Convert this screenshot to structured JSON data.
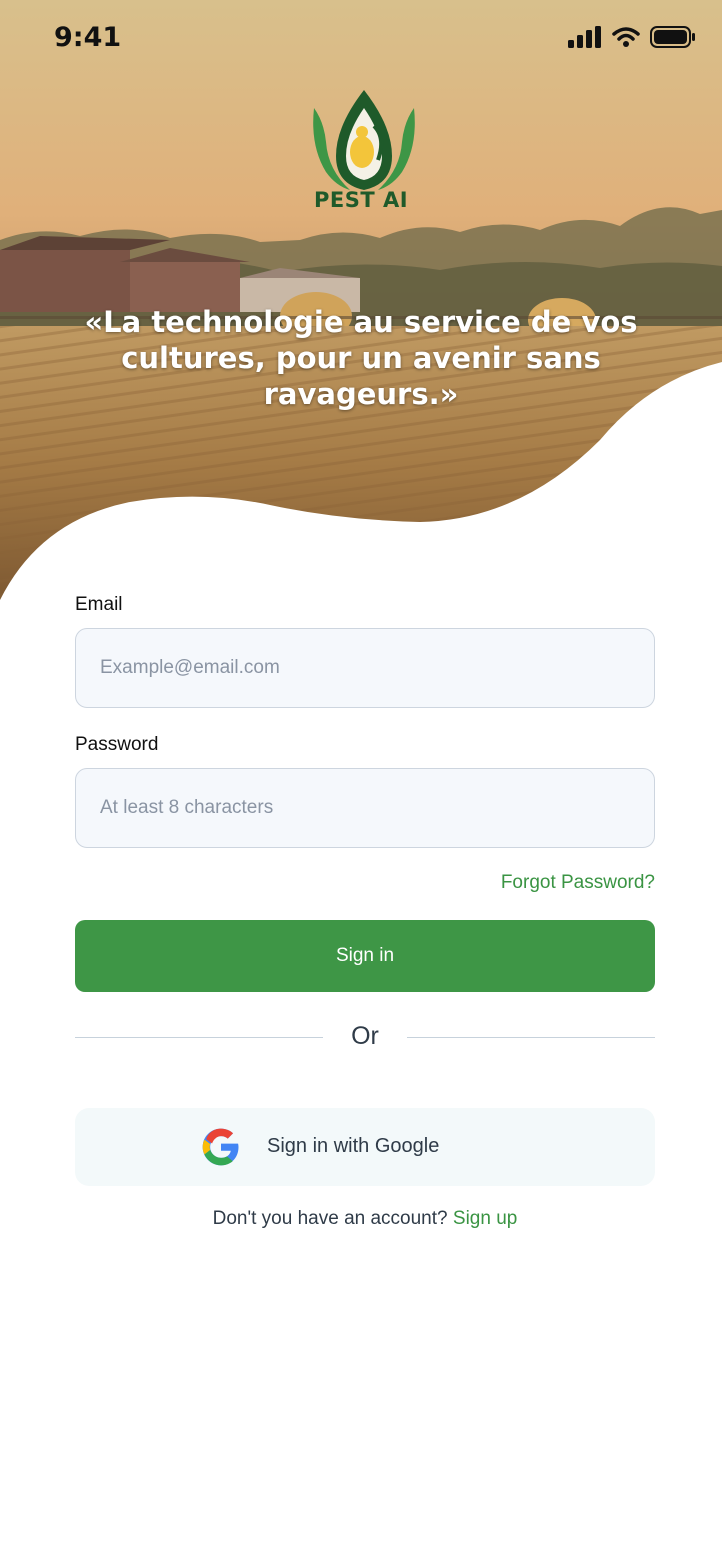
{
  "status_bar": {
    "time": "9:41"
  },
  "header": {
    "brand": "PEST AI",
    "tagline_line1": "«La technologie au service de vos",
    "tagline_line2": "cultures, pour un avenir sans ravageurs.»"
  },
  "form": {
    "email_label": "Email",
    "email_placeholder": "Example@email.com",
    "email_value": "",
    "password_label": "Password",
    "password_placeholder": "At least 8 characters",
    "password_value": "",
    "forgot_label": "Forgot Password?",
    "signin_label": "Sign in",
    "or_label": "Or",
    "google_label": "Sign in with Google",
    "no_account_text": "Don't you have an account? ",
    "signup_label": "Sign up"
  },
  "icons": {
    "logo": "pest-ai-leaf-logo",
    "google": "google-g-icon",
    "signal": "cellular-signal-icon",
    "wifi": "wifi-icon",
    "battery": "battery-icon"
  },
  "colors": {
    "accent": "#3e9646",
    "link": "#3a9443",
    "brand_text": "#1f5a2a"
  }
}
